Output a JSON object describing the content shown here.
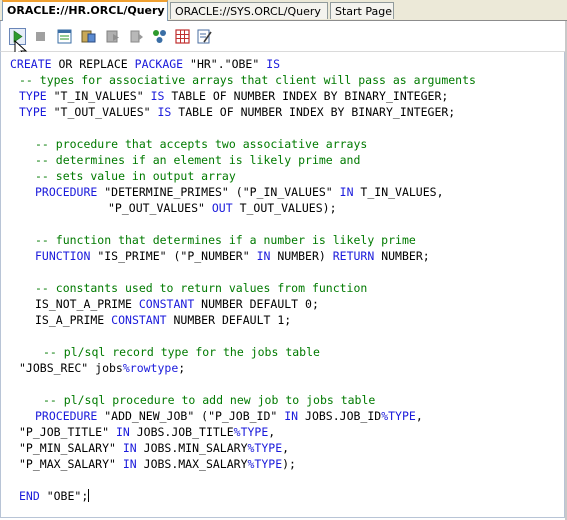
{
  "tabs": [
    {
      "label": "ORACLE://HR.ORCL/Query",
      "active": true
    },
    {
      "label": "ORACLE://SYS.ORCL/Query",
      "active": false
    },
    {
      "label": "Start Page",
      "active": false
    }
  ],
  "toolbar": {
    "buttons": [
      {
        "icon": "run-icon",
        "tooltip": ""
      },
      {
        "icon": "stop-icon"
      },
      {
        "icon": "sql-history-icon"
      },
      {
        "icon": "commit-icon"
      },
      {
        "icon": "rollback-icon"
      },
      {
        "icon": "step-icon"
      },
      {
        "icon": "connection-icon"
      },
      {
        "icon": "grid-icon"
      },
      {
        "icon": "edit-icon"
      }
    ]
  },
  "code": {
    "l1": [
      "CREATE",
      " OR REPLACE ",
      "PACKAGE",
      " \"HR\".\"OBE\" ",
      "IS"
    ],
    "l2": "-- types for associative arrays that client will pass as arguments",
    "l3": [
      "TYPE",
      " \"T_IN_VALUES\" ",
      "IS",
      " TABLE OF NUMBER INDEX BY BINARY_INTEGER;"
    ],
    "l4": [
      "TYPE",
      " \"T_OUT_VALUES\" ",
      "IS",
      " TABLE OF NUMBER INDEX BY BINARY_INTEGER;"
    ],
    "l5": "-- procedure that accepts two associative arrays",
    "l6": "-- determines if an element is likely prime and",
    "l7": "-- sets value in output array",
    "l8": [
      "PROCEDURE",
      " \"DETERMINE_PRIMES\" (\"P_IN_VALUES\" ",
      "IN",
      " T_IN_VALUES,"
    ],
    "l9": [
      "\"P_OUT_VALUES\" ",
      "OUT",
      " T_OUT_VALUES);"
    ],
    "l10": "-- function that determines if a number is likely prime",
    "l11": [
      "FUNCTION",
      " \"IS_PRIME\" (\"P_NUMBER\" ",
      "IN",
      " NUMBER) ",
      "RETURN",
      " NUMBER;"
    ],
    "l12": "-- constants used to return values from function",
    "l13": [
      "IS_NOT_A_PRIME ",
      "CONSTANT",
      " NUMBER DEFAULT 0;"
    ],
    "l14": [
      "IS_A_PRIME ",
      "CONSTANT",
      " NUMBER DEFAULT 1;"
    ],
    "l15": "-- pl/sql record type for the jobs table",
    "l16": [
      "\"JOBS_REC\" jobs",
      "%rowtype",
      ";"
    ],
    "l17": "-- pl/sql procedure to add new job to jobs table",
    "l18": [
      "PROCEDURE",
      " \"ADD_NEW_JOB\" (\"P_JOB_ID\" ",
      "IN",
      " JOBS.JOB_ID",
      "%TYPE",
      ","
    ],
    "l19": [
      "\"P_JOB_TITLE\" ",
      "IN",
      " JOBS.JOB_TITLE",
      "%TYPE",
      ","
    ],
    "l20": [
      "\"P_MIN_SALARY\" ",
      "IN",
      " JOBS.MIN_SALARY",
      "%TYPE",
      ","
    ],
    "l21": [
      "\"P_MAX_SALARY\" ",
      "IN",
      " JOBS.MAX_SALARY",
      "%TYPE",
      ");"
    ],
    "l22": [
      "END",
      " \"OBE\";"
    ]
  },
  "colors": {
    "keyword": "#1a1adb",
    "comment": "#007a00",
    "active_tab_accent": "#f0a030"
  }
}
